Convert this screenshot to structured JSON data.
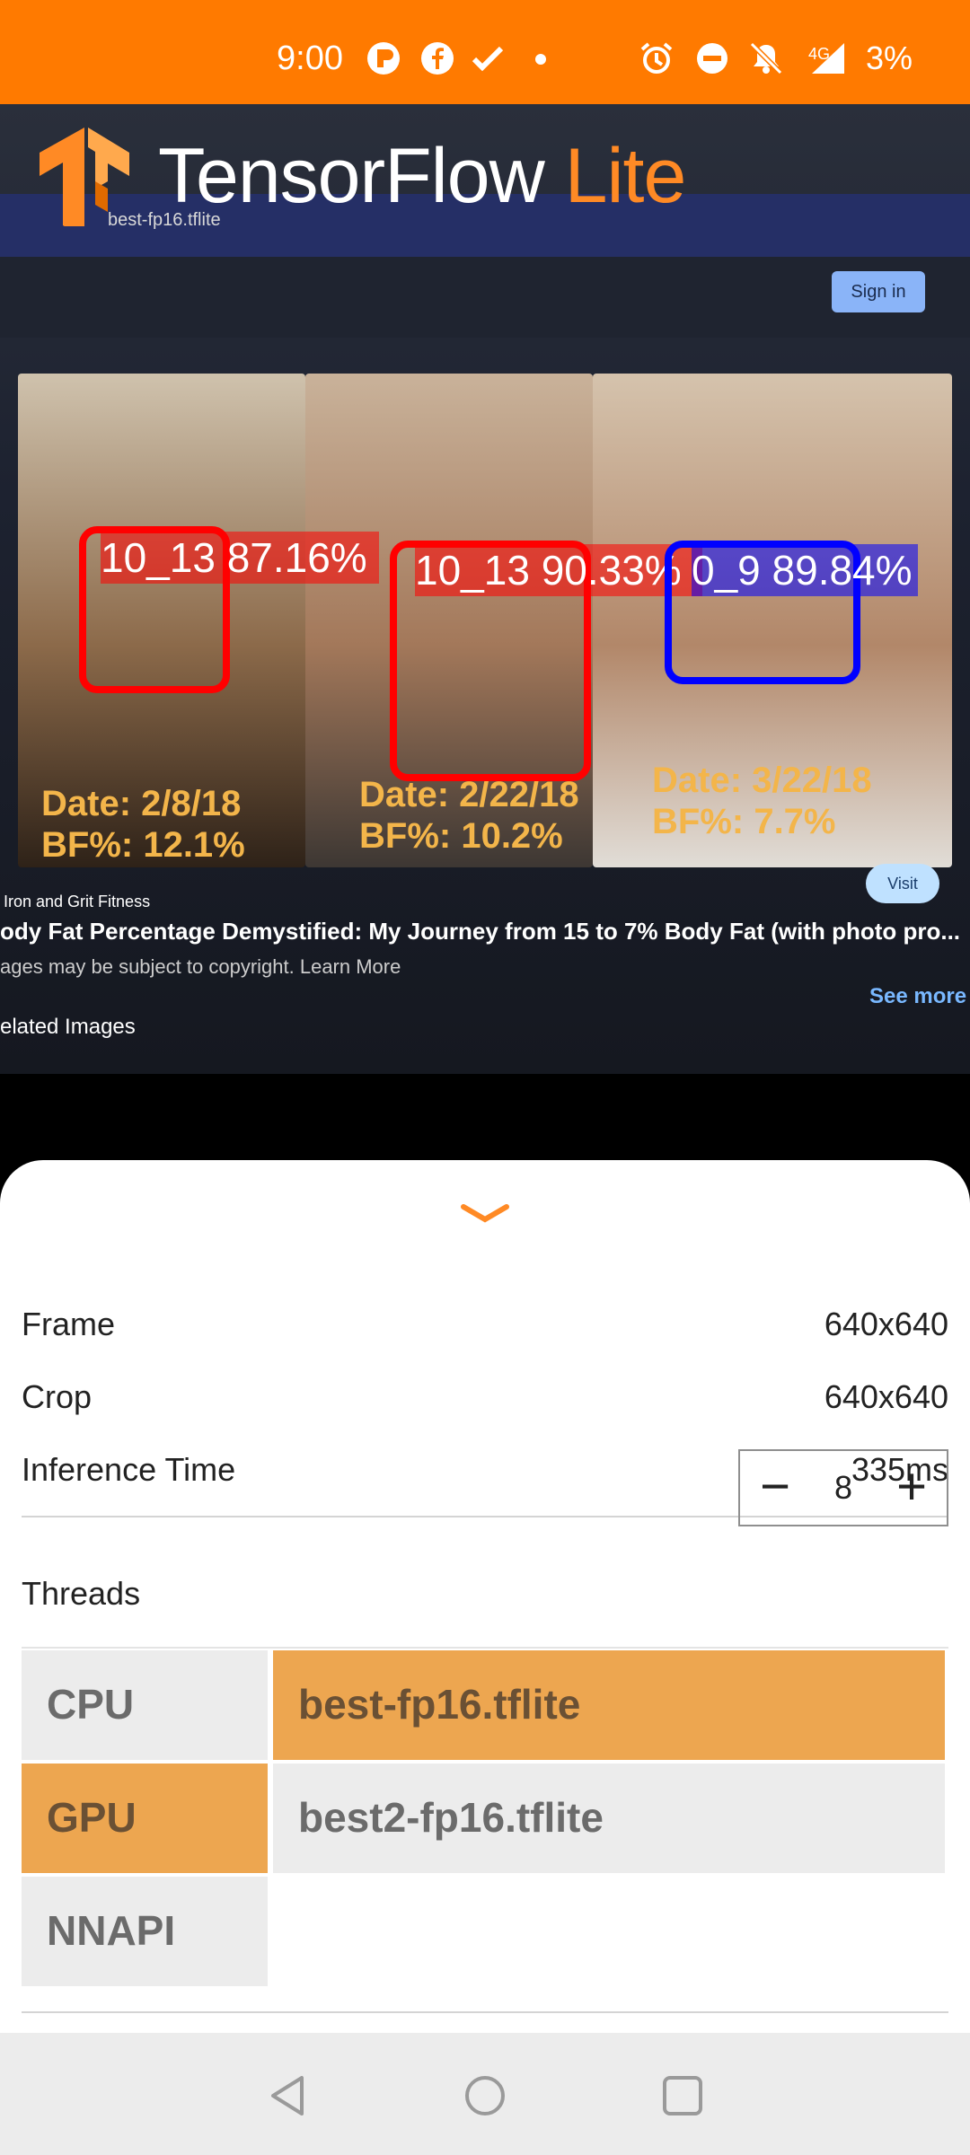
{
  "status_bar": {
    "time": "9:00",
    "network": "4G",
    "battery": "3%",
    "icons": [
      "app-icon",
      "facebook-icon",
      "check-icon",
      "dot-icon",
      "alarm-icon",
      "dnd-icon",
      "mute-icon",
      "signal-icon"
    ]
  },
  "app": {
    "logo_name": "TensorFlow",
    "logo_suffix": "Lite",
    "accent": "#FF8A25"
  },
  "preview": {
    "photo_captions": [
      {
        "date": "Date: 2/8/18",
        "bf": "BF%: 12.1%"
      },
      {
        "date": "Date: 2/22/18",
        "bf": "BF%: 10.2%"
      },
      {
        "date": "Date: 3/22/18",
        "bf": "BF%: 7.7%"
      }
    ],
    "source": "Iron and Grit Fitness",
    "headline": "ody Fat Percentage Demystified: My Journey from 15 to 7% Body Fat (with photo pro...",
    "copyright": "ages may be subject to copyright. Learn More",
    "related": "elated Images",
    "visit": "Visit",
    "see_more": "See more",
    "sign_in": "Sign in",
    "tab_label": "best-fp16.tflite"
  },
  "detections": [
    {
      "label": "10_13 87.16%",
      "color": "#FF0000"
    },
    {
      "label": "10_13 90.33%",
      "color": "#FF0000"
    },
    {
      "label": "0_9 89.84%",
      "color": "#0000FF"
    }
  ],
  "sheet": {
    "rows": [
      {
        "key": "Frame",
        "value": "640x640"
      },
      {
        "key": "Crop",
        "value": "640x640"
      },
      {
        "key": "Inference Time",
        "value": "335ms"
      }
    ],
    "threads": {
      "label": "Threads",
      "value": "8"
    },
    "delegates": [
      {
        "label": "CPU",
        "selected": false
      },
      {
        "label": "GPU",
        "selected": true
      },
      {
        "label": "NNAPI",
        "selected": false
      }
    ],
    "models": [
      {
        "label": "best-fp16.tflite",
        "selected": true
      },
      {
        "label": "best2-fp16.tflite",
        "selected": false
      }
    ],
    "selected_color": "#EDA650"
  },
  "nav": {
    "buttons": [
      "back-icon",
      "home-icon",
      "recents-icon"
    ]
  }
}
